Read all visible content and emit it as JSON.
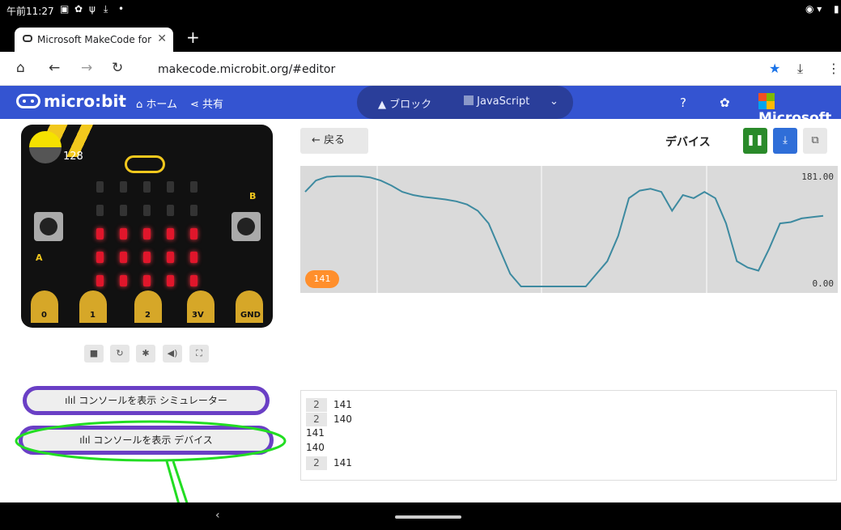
{
  "status": {
    "time": "午前11:27"
  },
  "browser": {
    "tab_title": "Microsoft MakeCode for micr",
    "url": "makecode.microbit.org/#editor"
  },
  "header": {
    "logo": "micro:bit",
    "home": "ホーム",
    "share": "共有",
    "blocks": "ブロック",
    "javascript": "JavaScript",
    "microsoft": "Microsoft"
  },
  "simulator": {
    "light_value": "128",
    "pins": [
      "0",
      "1",
      "2",
      "3V",
      "GND"
    ],
    "button_a": "A",
    "button_b": "B",
    "console_sim": "ılıl コンソールを表示 シミュレーター",
    "console_device": "ılıl コンソールを表示 デバイス",
    "leds": [
      [
        0,
        0,
        0,
        0,
        0
      ],
      [
        0,
        0,
        0,
        0,
        0
      ],
      [
        1,
        1,
        1,
        1,
        1
      ],
      [
        1,
        1,
        1,
        1,
        1
      ],
      [
        1,
        1,
        1,
        1,
        1
      ]
    ]
  },
  "panel": {
    "back_label": "← 戻る",
    "device_label": "デバイス",
    "chart_max": "181.00",
    "chart_min": "0.00",
    "current_value": "141"
  },
  "console_lines": [
    {
      "count": "2",
      "text": "141"
    },
    {
      "count": "2",
      "text": "140"
    },
    {
      "count": "",
      "text": "141"
    },
    {
      "count": "",
      "text": "140"
    },
    {
      "count": "2",
      "text": "141"
    }
  ],
  "chart_data": {
    "type": "line",
    "ylim": [
      0,
      181
    ],
    "values": [
      150,
      168,
      174,
      175,
      175,
      175,
      173,
      168,
      160,
      150,
      145,
      142,
      140,
      138,
      135,
      130,
      120,
      100,
      60,
      20,
      0,
      0,
      0,
      0,
      0,
      0,
      0,
      20,
      40,
      80,
      140,
      152,
      155,
      150,
      120,
      145,
      140,
      150,
      140,
      100,
      40,
      30,
      25,
      60,
      100,
      102,
      108,
      110,
      112
    ]
  }
}
